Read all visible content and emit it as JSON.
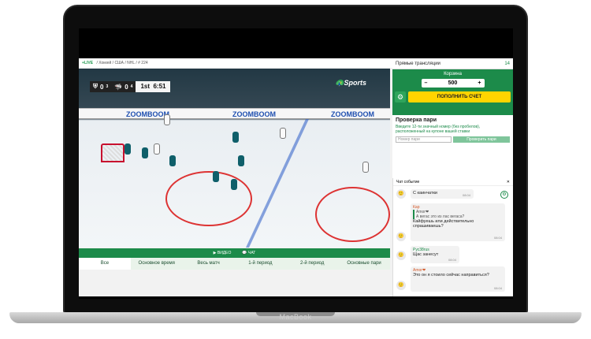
{
  "laptop_brand": "MacBook",
  "breadcrumb": {
    "live": "+LIVE",
    "path": "/ Хоккей / США / NHL / # 224"
  },
  "score": {
    "home": "0",
    "away": "0",
    "home_shots": "3",
    "away_shots": "4",
    "period": "1st",
    "clock": "6:51"
  },
  "broadcaster": "Sports",
  "ads": [
    "ZOOMBOOM",
    "ZOOMBOOM",
    "ZOOMBOOM"
  ],
  "controls": {
    "video": "ВИДЕО",
    "chat": "ЧАТ"
  },
  "tabs": [
    "Все",
    "Основное время",
    "Весь матч",
    "1-й период",
    "2-й период",
    "Основные пари"
  ],
  "side": {
    "title": "Прямые трансляции",
    "count": "14",
    "cart_label": "Корзина",
    "amount": "500",
    "minus": "–",
    "plus": "+",
    "topup": "ПОПОЛНИТЬ СЧЕТ",
    "check_title": "Проверка пари",
    "check_hint": "Введите 12-ти значный номер (без пробелов), расположенный на купоне вашей ставки",
    "check_placeholder": "Номер пари",
    "check_button": "Проверить пари"
  },
  "chat": {
    "title": "Чат событие",
    "close": "✕",
    "messages": [
      {
        "author": "",
        "text": "С каинчатки",
        "time": "08:04"
      },
      {
        "author": "Кар",
        "quote": "Amor❤",
        "quote2": "А вегас это из лас вегаса?",
        "text": "Кайфуешь или действительно спрашиваешь?",
        "time": "08:04"
      },
      {
        "author": "Рус38rus",
        "text": "Щас занесут",
        "time": "08:04"
      },
      {
        "author": "Amor❤",
        "text": "Это он я стоило сейчас направиться?",
        "time": "08:04"
      }
    ]
  }
}
